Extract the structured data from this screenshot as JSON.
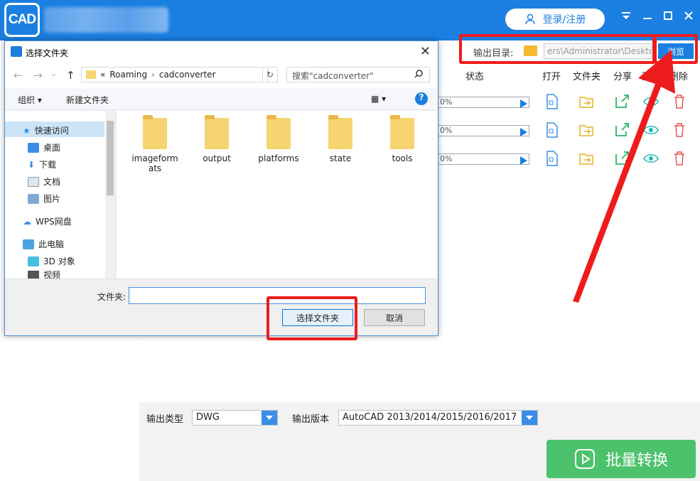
{
  "app": {
    "logo_text": "CAD",
    "login_label": "登录/注册"
  },
  "output": {
    "dir_label": "输出目录:",
    "dir_value": "ers\\Administrator\\Deskto",
    "browse_label": "浏览"
  },
  "table": {
    "headers": [
      "状态",
      "打开",
      "文件夹",
      "分享",
      "预",
      "删除"
    ],
    "rows": [
      {
        "progress": "0%"
      },
      {
        "progress": "0%"
      },
      {
        "progress": "0%"
      }
    ]
  },
  "options": {
    "type_label": "输出类型",
    "type_value": "DWG",
    "version_label": "输出版本",
    "version_value": "AutoCAD 2013/2014/2015/2016/2017"
  },
  "convert_label": "批量转换",
  "dialog": {
    "title": "选择文件夹",
    "breadcrumb": [
      "Roaming",
      "cadconverter"
    ],
    "breadcrumb_prefix": "«",
    "search_placeholder": "搜索\"cadconverter\"",
    "toolbar": {
      "organize": "组织",
      "new_folder": "新建文件夹"
    },
    "nav": [
      "快速访问",
      "桌面",
      "下载",
      "文档",
      "图片",
      "WPS网盘",
      "此电脑",
      "3D 对象",
      "视频"
    ],
    "files": [
      "imageformats",
      "output",
      "platforms",
      "state",
      "tools"
    ],
    "folder_label": "文件夹:",
    "folder_value": "",
    "select_button": "选择文件夹",
    "cancel_button": "取消"
  },
  "colors": {
    "brand": "#1a7fe0",
    "highlight": "#ee1c1c",
    "convert": "#4cc26c"
  }
}
